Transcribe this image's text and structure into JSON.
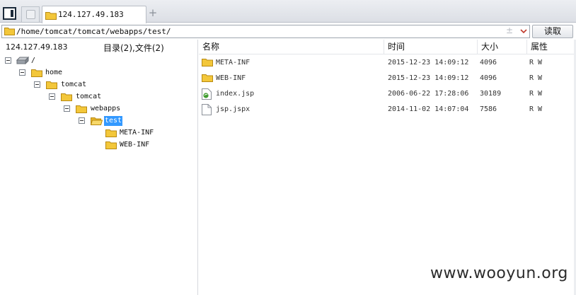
{
  "tabs": [
    {
      "label": "124.127.49.183",
      "active": true
    }
  ],
  "address": {
    "path": "/home/tomcat/tomcat/webapps/test/",
    "plus_glyph": "±",
    "read_button": "读取"
  },
  "tree": {
    "host": "124.127.49.183",
    "summary": "目录(2),文件(2)",
    "nodes": [
      {
        "label": "/",
        "icon": "drive-icon",
        "depth": 0,
        "expanded": true
      },
      {
        "label": "home",
        "icon": "folder-icon",
        "depth": 1,
        "expanded": true
      },
      {
        "label": "tomcat",
        "icon": "folder-icon",
        "depth": 2,
        "expanded": true
      },
      {
        "label": "tomcat",
        "icon": "folder-icon",
        "depth": 3,
        "expanded": true
      },
      {
        "label": "webapps",
        "icon": "folder-icon",
        "depth": 4,
        "expanded": true
      },
      {
        "label": "test",
        "icon": "folder-open-icon",
        "depth": 5,
        "expanded": true,
        "selected": true
      },
      {
        "label": "META-INF",
        "icon": "folder-icon",
        "depth": 6
      },
      {
        "label": "WEB-INF",
        "icon": "folder-icon",
        "depth": 6
      }
    ]
  },
  "list": {
    "columns": [
      "名称",
      "时间",
      "大小",
      "属性"
    ],
    "rows": [
      {
        "name": "META-INF",
        "icon": "folder-icon",
        "time": "2015-12-23 14:09:12",
        "size": "4096",
        "attr": "R W"
      },
      {
        "name": "WEB-INF",
        "icon": "folder-icon",
        "time": "2015-12-23 14:09:12",
        "size": "4096",
        "attr": "R W"
      },
      {
        "name": "index.jsp",
        "icon": "jsp-file-icon",
        "time": "2006-06-22 17:28:06",
        "size": "30189",
        "attr": "R W"
      },
      {
        "name": "jsp.jspx",
        "icon": "file-icon",
        "time": "2014-11-02 14:07:04",
        "size": "7586",
        "attr": "R W"
      }
    ]
  },
  "watermark": "www.wooyun.org",
  "colors": {
    "selection": "#3399ff",
    "folder": "#f3c73a",
    "dropdown_arrow": "#c0392b"
  }
}
